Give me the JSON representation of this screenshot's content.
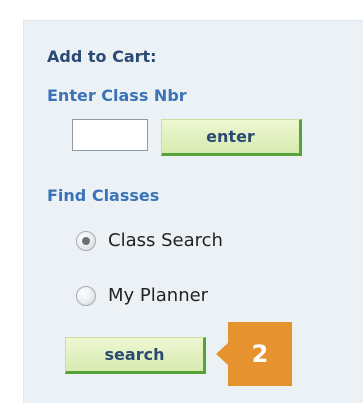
{
  "add_to_cart": {
    "title": "Add to Cart:",
    "enter_label": "Enter Class Nbr",
    "input_value": "",
    "enter_button": "enter"
  },
  "find_classes": {
    "title": "Find Classes",
    "options": [
      {
        "label": "Class Search",
        "selected": true
      },
      {
        "label": "My Planner",
        "selected": false
      }
    ],
    "search_button": "search"
  },
  "callout": {
    "number": "2",
    "color": "#e6922e"
  },
  "colors": {
    "panel_bg": "#ecf1f6",
    "heading": "#2b4a73",
    "sublabel": "#3a74b6",
    "button_bg": "#d7ebb0",
    "button_shadow": "#55a43a"
  }
}
